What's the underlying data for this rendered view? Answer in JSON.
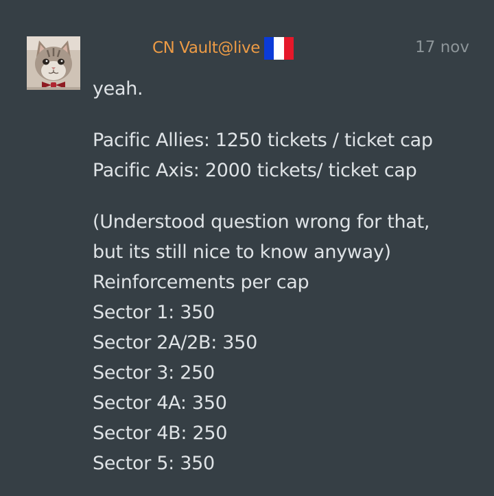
{
  "author": {
    "name": "CN Vault@live",
    "flag_icon": "france-flag-icon",
    "flag_colors": [
      "#0b3bd8",
      "#ffffff",
      "#e5182a"
    ]
  },
  "avatar_icon": "cat-avatar",
  "timestamp": "17 nov",
  "colors": {
    "background": "#363f45",
    "author": "#ed9b45",
    "text": "#dfe3e6",
    "timestamp": "#8d9599"
  },
  "message": {
    "intro": "yeah.",
    "tickets": [
      "Pacific Allies: 1250 tickets / ticket cap",
      "Pacific Axis: 2000 tickets/ ticket cap"
    ],
    "note_line1": "(Understood question wrong for that,",
    "note_line2": "but its still nice to know anyway)",
    "reinforcements_heading": "Reinforcements per cap",
    "sectors": [
      "Sector 1: 350",
      "Sector 2A/2B: 350",
      "Sector 3: 250",
      "Sector 4A: 350",
      "Sector 4B: 250",
      "Sector 5: 350"
    ]
  }
}
